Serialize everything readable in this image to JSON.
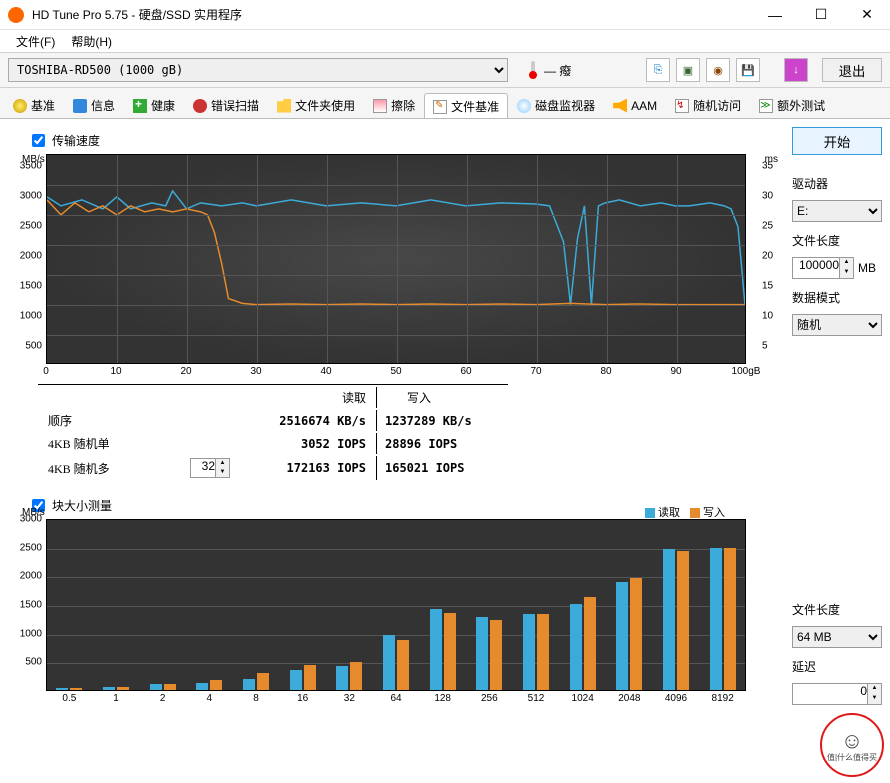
{
  "window": {
    "title": "HD Tune Pro 5.75 - 硬盘/SSD 实用程序"
  },
  "menu": {
    "file": "文件(F)",
    "help": "帮助(H)"
  },
  "toolbar": {
    "drive": "TOSHIBA-RD500 (1000 gB)",
    "temp": "— 癈",
    "exit": "退出"
  },
  "tabs": {
    "benchmark": "基准",
    "info": "信息",
    "health": "健康",
    "errorscan": "错误扫描",
    "folder": "文件夹使用",
    "erase": "擦除",
    "filebench": "文件基准",
    "diskmon": "磁盘监视器",
    "aam": "AAM",
    "random": "随机访问",
    "extra": "额外测试"
  },
  "labels": {
    "transfer": "传输速度",
    "block": "块大小测量",
    "read": "读取",
    "write": "写入",
    "seq": "顺序",
    "rand1": "4KB 随机单",
    "randN": "4KB 随机多",
    "start": "开始",
    "drive_lbl": "驱动器",
    "filelen": "文件长度",
    "mode": "数据模式",
    "mb": "MB",
    "delay": "延迟",
    "legend_read": "读取",
    "legend_write": "写入"
  },
  "side": {
    "drive": "E:",
    "filelen": "100000",
    "mode": "随机",
    "filelen2": "64 MB",
    "delay": "0"
  },
  "results": {
    "seq_read": "2516674 KB/s",
    "seq_write": "1237289 KB/s",
    "r1_read": "3052 IOPS",
    "r1_write": "28896 IOPS",
    "rn_read": "172163 IOPS",
    "rn_write": "165021 IOPS",
    "queue": "32"
  },
  "watermark": {
    "text": "值|什么值得买"
  },
  "chart_data": [
    {
      "type": "line",
      "title": "传输速度",
      "xlabel": "gB",
      "x_range": [
        0,
        100
      ],
      "y1": {
        "label": "MB/s",
        "range": [
          0,
          3500
        ]
      },
      "y2": {
        "label": "ms",
        "range": [
          0,
          35
        ]
      },
      "series": [
        {
          "name": "读取",
          "axis": "y1",
          "color": "#3cabd9",
          "x": [
            0,
            2,
            5,
            8,
            10,
            12,
            15,
            17,
            18,
            20,
            22,
            25,
            28,
            30,
            35,
            40,
            45,
            50,
            55,
            60,
            65,
            70,
            72,
            74,
            75,
            76,
            77,
            78,
            79,
            80,
            82,
            85,
            88,
            90,
            92,
            95,
            97,
            98,
            99,
            100
          ],
          "values": [
            2800,
            2650,
            2750,
            2600,
            2800,
            2600,
            2700,
            2650,
            2900,
            2600,
            2700,
            2650,
            2700,
            2650,
            2750,
            2650,
            2700,
            2650,
            2750,
            2650,
            2700,
            2680,
            2650,
            2050,
            1000,
            2100,
            2650,
            1000,
            2650,
            2700,
            2750,
            2650,
            2700,
            2650,
            2650,
            2700,
            2650,
            2600,
            2300,
            1000
          ]
        },
        {
          "name": "写入",
          "axis": "y1",
          "color": "#e68a2e",
          "x": [
            0,
            2,
            4,
            6,
            8,
            10,
            12,
            14,
            16,
            18,
            20,
            22,
            23,
            24,
            25,
            26,
            28,
            30,
            35,
            40,
            45,
            50,
            55,
            60,
            65,
            70,
            75,
            80,
            85,
            90,
            95,
            100
          ],
          "values": [
            2750,
            2500,
            2700,
            2550,
            2650,
            2500,
            2650,
            2550,
            2600,
            2550,
            2600,
            2550,
            2500,
            2200,
            1700,
            1100,
            1020,
            1000,
            1010,
            1000,
            1010,
            1000,
            1010,
            1000,
            1010,
            1000,
            1020,
            1000,
            1010,
            1000,
            1000,
            1000
          ]
        }
      ]
    },
    {
      "type": "bar",
      "title": "块大小测量",
      "ylabel": "MB/s",
      "ylim": [
        0,
        3000
      ],
      "categories": [
        "0.5",
        "1",
        "2",
        "4",
        "8",
        "16",
        "32",
        "64",
        "128",
        "256",
        "512",
        "1024",
        "2048",
        "4096",
        "8192"
      ],
      "series": [
        {
          "name": "读取",
          "color": "#3cabd9",
          "values": [
            30,
            60,
            100,
            130,
            200,
            350,
            420,
            960,
            1420,
            1280,
            1320,
            1500,
            1890,
            2460,
            2480
          ]
        },
        {
          "name": "写入",
          "color": "#e68a2e",
          "values": [
            40,
            60,
            110,
            180,
            290,
            440,
            480,
            880,
            1350,
            1220,
            1320,
            1620,
            1960,
            2430,
            2480
          ]
        }
      ]
    }
  ]
}
